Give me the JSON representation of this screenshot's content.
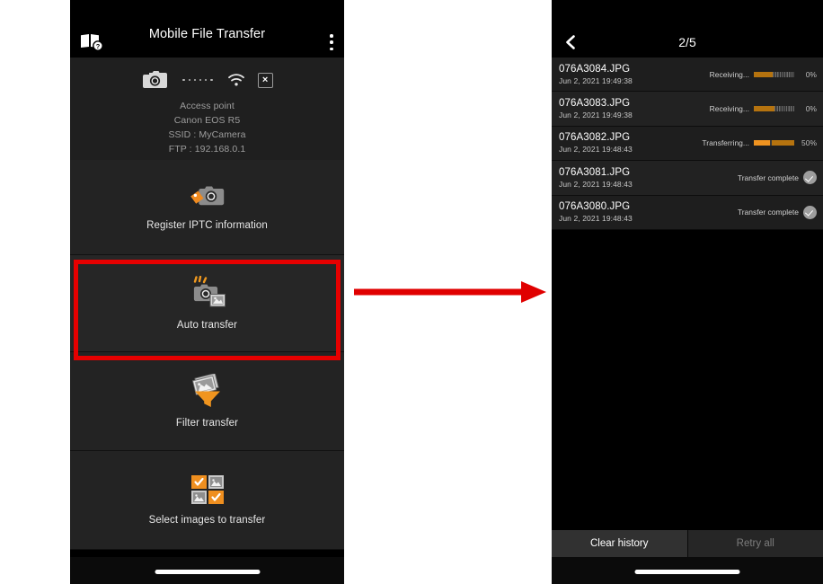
{
  "left_phone": {
    "app_bar": {
      "title": "Mobile File Transfer",
      "manual_icon": "book-help-icon",
      "overflow_icon": "overflow-menu-icon"
    },
    "connection": {
      "camera_icon": "camera-icon",
      "link_dots_icon": "connection-dots-icon",
      "wifi_icon": "wifi-icon",
      "disconnect_label": "×",
      "lines": [
        "Access point",
        "Canon EOS R5",
        "SSID : MyCamera",
        "FTP : 192.168.0.1"
      ]
    },
    "menu_items": [
      {
        "id": "iptc",
        "label": "Register IPTC information",
        "icon": "camera-tag-icon"
      },
      {
        "id": "auto",
        "label": "Auto transfer",
        "icon": "camera-auto-transfer-icon"
      },
      {
        "id": "filter",
        "label": "Filter transfer",
        "icon": "photo-funnel-icon"
      },
      {
        "id": "select",
        "label": "Select images to transfer",
        "icon": "image-grid-check-icon"
      }
    ]
  },
  "annotation": {
    "highlight_color": "#e60000",
    "arrow_color": "#e00000",
    "highlight_target": "Auto transfer"
  },
  "right_phone": {
    "app_bar": {
      "back_icon": "chevron-left-icon",
      "title": "2/5"
    },
    "transfers": [
      {
        "filename": "076A3084.JPG",
        "timestamp": "Jun 2, 2021 19:49:38",
        "status": "Receiving...",
        "percent": "0%",
        "progress": 0,
        "state": "receiving"
      },
      {
        "filename": "076A3083.JPG",
        "timestamp": "Jun 2, 2021 19:49:38",
        "status": "Receiving...",
        "percent": "0%",
        "progress": 0,
        "state": "receiving"
      },
      {
        "filename": "076A3082.JPG",
        "timestamp": "Jun 2, 2021 19:48:43",
        "status": "Transferring...",
        "percent": "50%",
        "progress": 50,
        "state": "transferring"
      },
      {
        "filename": "076A3081.JPG",
        "timestamp": "Jun 2, 2021 19:48:43",
        "status": "Transfer complete",
        "percent": "",
        "progress": 100,
        "state": "complete"
      },
      {
        "filename": "076A3080.JPG",
        "timestamp": "Jun 2, 2021 19:48:43",
        "status": "Transfer complete",
        "percent": "",
        "progress": 100,
        "state": "complete"
      }
    ],
    "footer": {
      "clear_history_label": "Clear history",
      "retry_all_label": "Retry all"
    }
  }
}
